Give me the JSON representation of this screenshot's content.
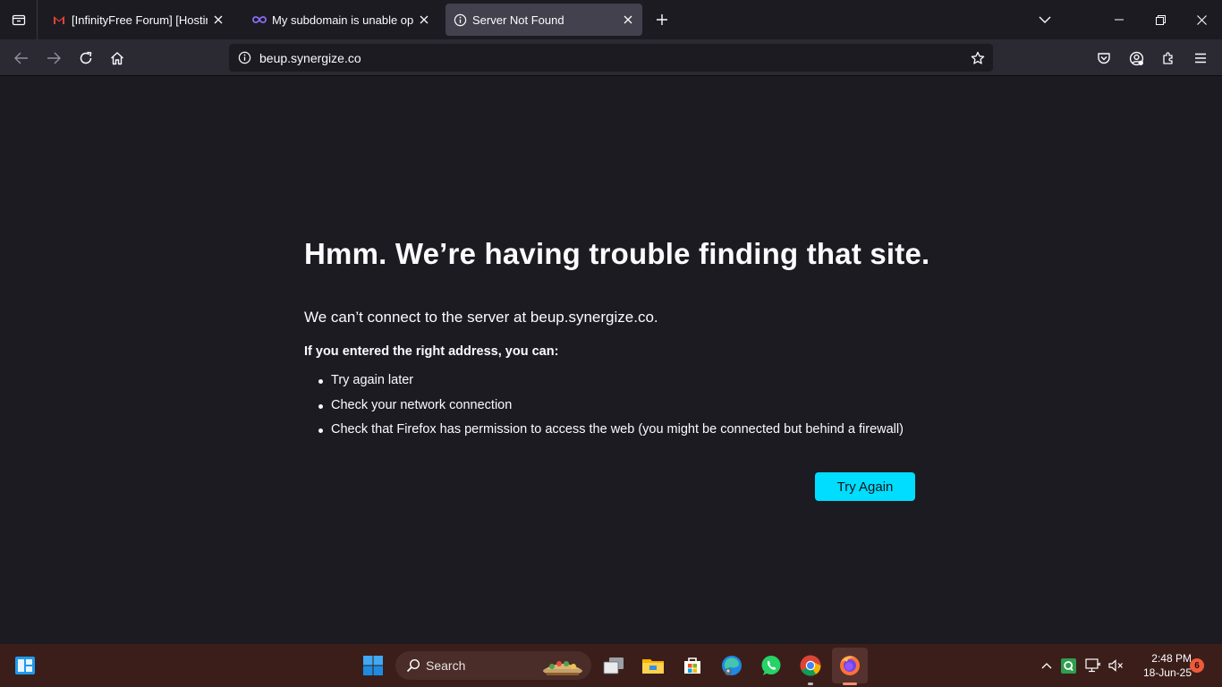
{
  "tabs": [
    {
      "label": "[InfinityFree Forum] [Hosting Su",
      "icon": "gmail-icon",
      "active": false
    },
    {
      "label": "My subdomain is unable open. (",
      "icon": "infinity-icon",
      "active": false
    },
    {
      "label": "Server Not Found",
      "icon": "info-icon",
      "active": true
    }
  ],
  "navbar": {
    "url": "beup.synergize.co"
  },
  "error": {
    "title": "Hmm. We’re having trouble finding that site.",
    "description": "We can’t connect to the server at beup.synergize.co.",
    "subtitle": "If you entered the right address, you can:",
    "items": [
      "Try again later",
      "Check your network connection",
      "Check that Firefox has permission to access the web (you might be connected but behind a firewall)"
    ],
    "button": "Try Again"
  },
  "taskbar": {
    "search_label": "Search",
    "time": "2:48 PM",
    "date": "18-Jun-25",
    "notification_count": "6"
  },
  "colors": {
    "accent": "#00ddff",
    "background": "#1c1b22",
    "taskbar": "#3b1e1a"
  }
}
